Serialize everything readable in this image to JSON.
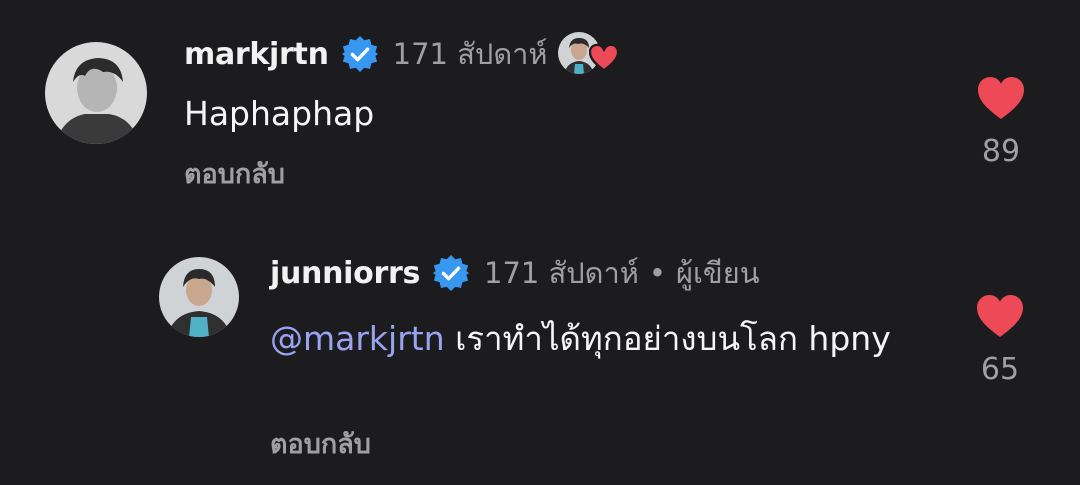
{
  "comments": [
    {
      "username": "markjrtn",
      "age": "171 สัปดาห์",
      "text": "Haphaphap",
      "reply_label": "ตอบกลับ",
      "like_count": "89",
      "author_liked": true
    },
    {
      "username": "junniorrs",
      "age": "171 สัปดาห์",
      "separator": "•",
      "author_label": "ผู้เขียน",
      "mention": "@markjrtn",
      "text": " เราทำได้ทุกอย่างบนโลก hpny",
      "reply_label": "ตอบกลับ",
      "like_count": "65"
    }
  ],
  "colors": {
    "background": "#1c1c1e",
    "heart": "#ed4956",
    "verified": "#3897f0",
    "mention": "#9aa3f2",
    "muted_text": "#a0a0a3"
  },
  "icons": [
    "verified-badge-icon",
    "heart-icon"
  ]
}
